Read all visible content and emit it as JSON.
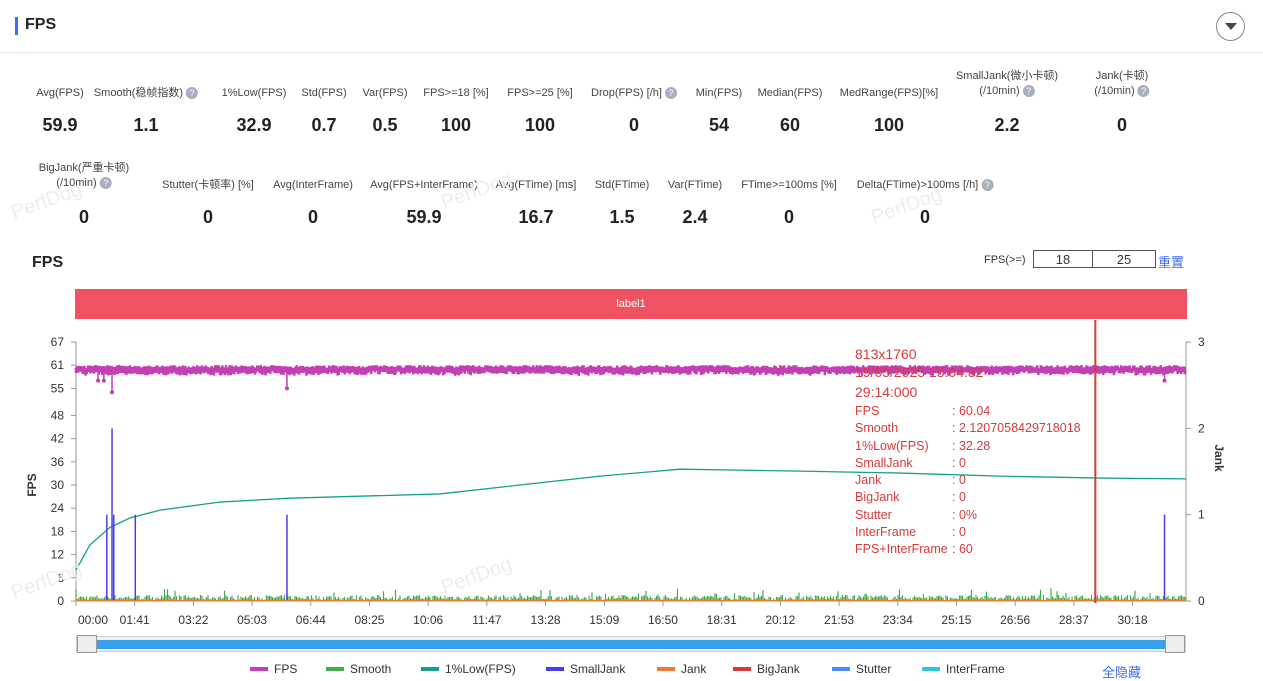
{
  "header": {
    "title": "FPS"
  },
  "stats_row1": [
    {
      "label": "Avg(FPS)",
      "value": "59.9"
    },
    {
      "label": "Smooth(稳帧指数)",
      "value": "1.1",
      "help": true
    },
    {
      "label": "1%Low(FPS)",
      "value": "32.9"
    },
    {
      "label": "Std(FPS)",
      "value": "0.7"
    },
    {
      "label": "Var(FPS)",
      "value": "0.5"
    },
    {
      "label": "FPS>=18 [%]",
      "value": "100"
    },
    {
      "label": "FPS>=25 [%]",
      "value": "100"
    },
    {
      "label": "Drop(FPS) [/h]",
      "value": "0",
      "help": true
    },
    {
      "label": "Min(FPS)",
      "value": "54"
    },
    {
      "label": "Median(FPS)",
      "value": "60"
    },
    {
      "label": "MedRange(FPS)[%]",
      "value": "100"
    },
    {
      "label": "SmallJank(微小卡顿)",
      "label2": "(/10min)",
      "value": "2.2",
      "help": true
    },
    {
      "label": "Jank(卡顿)",
      "label2": "(/10min)",
      "value": "0",
      "help": true
    }
  ],
  "stats_row2": [
    {
      "label": "BigJank(严重卡顿)",
      "label2": "(/10min)",
      "value": "0",
      "help": true
    },
    {
      "label": "Stutter(卡顿率) [%]",
      "value": "0"
    },
    {
      "label": "Avg(InterFrame)",
      "value": "0"
    },
    {
      "label": "Avg(FPS+InterFrame)",
      "value": "59.9"
    },
    {
      "label": "Avg(FTime) [ms]",
      "value": "16.7"
    },
    {
      "label": "Std(FTime)",
      "value": "1.5"
    },
    {
      "label": "Var(FTime)",
      "value": "2.4"
    },
    {
      "label": "FTime>=100ms [%]",
      "value": "0"
    },
    {
      "label": "Delta(FTime)>100ms [/h]",
      "value": "0",
      "help": true
    }
  ],
  "watermark": "PerfDog",
  "chart": {
    "title": "FPS",
    "fps_ge_label": "FPS(>=)",
    "fps_threshold_1": "18",
    "fps_threshold_2": "25",
    "reset_label": "重置",
    "label_band": "label1",
    "hide_all_label": "全隐藏"
  },
  "tooltip": {
    "resolution": "813x1760",
    "datetime": "19/05/2025 15:04:32",
    "time": "29:14:000",
    "rows": [
      {
        "k": "FPS",
        "v": ": 60.04"
      },
      {
        "k": "Smooth",
        "v": ": 2.1207058429718018"
      },
      {
        "k": "1%Low(FPS)",
        "v": ": 32.28"
      },
      {
        "k": "SmallJank",
        "v": ": 0"
      },
      {
        "k": "Jank",
        "v": ": 0"
      },
      {
        "k": "BigJank",
        "v": ": 0"
      },
      {
        "k": "Stutter",
        "v": ": 0%"
      },
      {
        "k": "InterFrame",
        "v": ": 0"
      },
      {
        "k": "FPS+InterFrame",
        "v": ": 60"
      }
    ]
  },
  "chart_data": {
    "type": "line",
    "xlabel": "",
    "ylabel": "FPS",
    "y2label": "Jank",
    "x_ticks": [
      "00:00",
      "01:41",
      "03:22",
      "05:03",
      "06:44",
      "08:25",
      "10:06",
      "11:47",
      "13:28",
      "15:09",
      "16:50",
      "18:31",
      "20:12",
      "21:53",
      "23:34",
      "25:15",
      "26:56",
      "28:37",
      "30:18"
    ],
    "xlim_seconds": [
      0,
      1910
    ],
    "y_ticks": [
      0,
      6,
      12,
      18,
      24,
      30,
      36,
      42,
      48,
      55,
      61,
      67
    ],
    "ylim": [
      0,
      67
    ],
    "y2_ticks": [
      0,
      1,
      2,
      3
    ],
    "y2lim": [
      0,
      3
    ],
    "cursor_time_seconds": 1754,
    "series": [
      {
        "name": "FPS",
        "color": "#c43eb4",
        "baseline": 60,
        "dips": [
          [
            38,
            57
          ],
          [
            48,
            57
          ],
          [
            62,
            54
          ],
          [
            363,
            55
          ],
          [
            1873,
            57
          ]
        ]
      },
      {
        "name": "Smooth",
        "color": "#3fae4f"
      },
      {
        "name": "1%Low(FPS)",
        "color": "#14a08c",
        "points": [
          [
            0,
            8
          ],
          [
            24,
            14.5
          ],
          [
            58,
            19
          ],
          [
            93,
            21.5
          ],
          [
            145,
            23.5
          ],
          [
            248,
            25.6
          ],
          [
            368,
            26.6
          ],
          [
            626,
            27.7
          ],
          [
            764,
            30
          ],
          [
            902,
            32.3
          ],
          [
            1039,
            34.1
          ],
          [
            1246,
            33.6
          ],
          [
            1418,
            33.1
          ],
          [
            1590,
            32.3
          ],
          [
            1762,
            31.8
          ],
          [
            1910,
            31.6
          ]
        ]
      },
      {
        "name": "SmallJank",
        "color": "#4b3cf0",
        "axis": "right",
        "points": [
          [
            53,
            1
          ],
          [
            62,
            2
          ],
          [
            65,
            1
          ],
          [
            102,
            1
          ],
          [
            363,
            1
          ],
          [
            1873,
            1
          ]
        ]
      },
      {
        "name": "Jank",
        "color": "#f07828",
        "axis": "right",
        "points": []
      },
      {
        "name": "BigJank",
        "color": "#d83a3a",
        "axis": "right",
        "points": []
      },
      {
        "name": "Stutter",
        "color": "#4a8af4",
        "points": []
      },
      {
        "name": "InterFrame",
        "color": "#2cc6d8",
        "points": []
      }
    ]
  }
}
